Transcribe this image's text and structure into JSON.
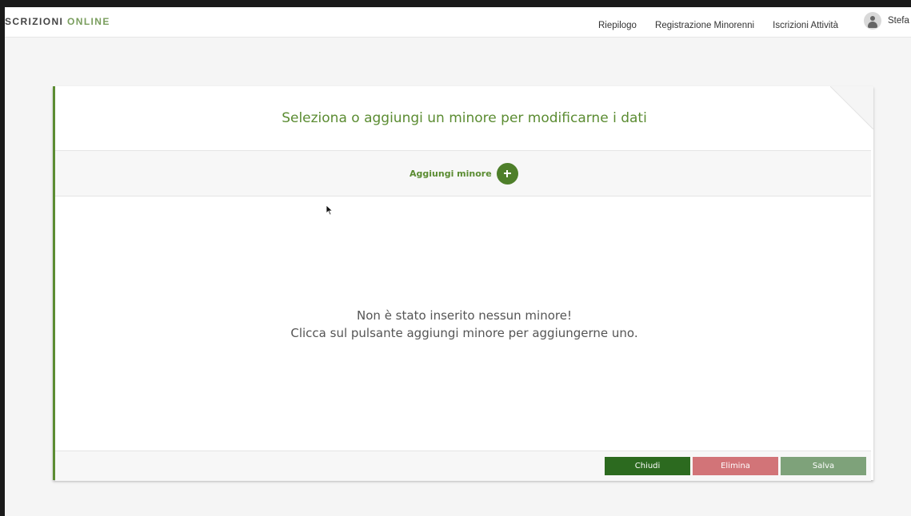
{
  "app": {
    "brand_part1": "SCRIZIONI ",
    "brand_part2": "ONLINE",
    "brand_accent_color": "#7a9e5e"
  },
  "nav": {
    "items": [
      {
        "label": "Riepilogo"
      },
      {
        "label": "Registrazione Minorenni"
      },
      {
        "label": "Iscrizioni Attività"
      }
    ],
    "user_name": "Stefa",
    "avatar_icon": "user-avatar-icon"
  },
  "card": {
    "title": "Seleziona o aggiungi un minore per modificarne i dati",
    "add_label": "Aggiungi minore",
    "add_icon": "plus-circle-icon",
    "empty_line1": "Non è stato inserito nessun minore!",
    "empty_line2": "Clicca sul pulsante aggiungi minore per aggiungerne uno.",
    "accent_color": "#5b8c32"
  },
  "footer": {
    "close_label": "Chiudi",
    "delete_label": "Elimina",
    "save_label": "Salva",
    "colors": {
      "close": "#2c6a1f",
      "delete": "#d27478",
      "save": "#7ea27a"
    }
  }
}
